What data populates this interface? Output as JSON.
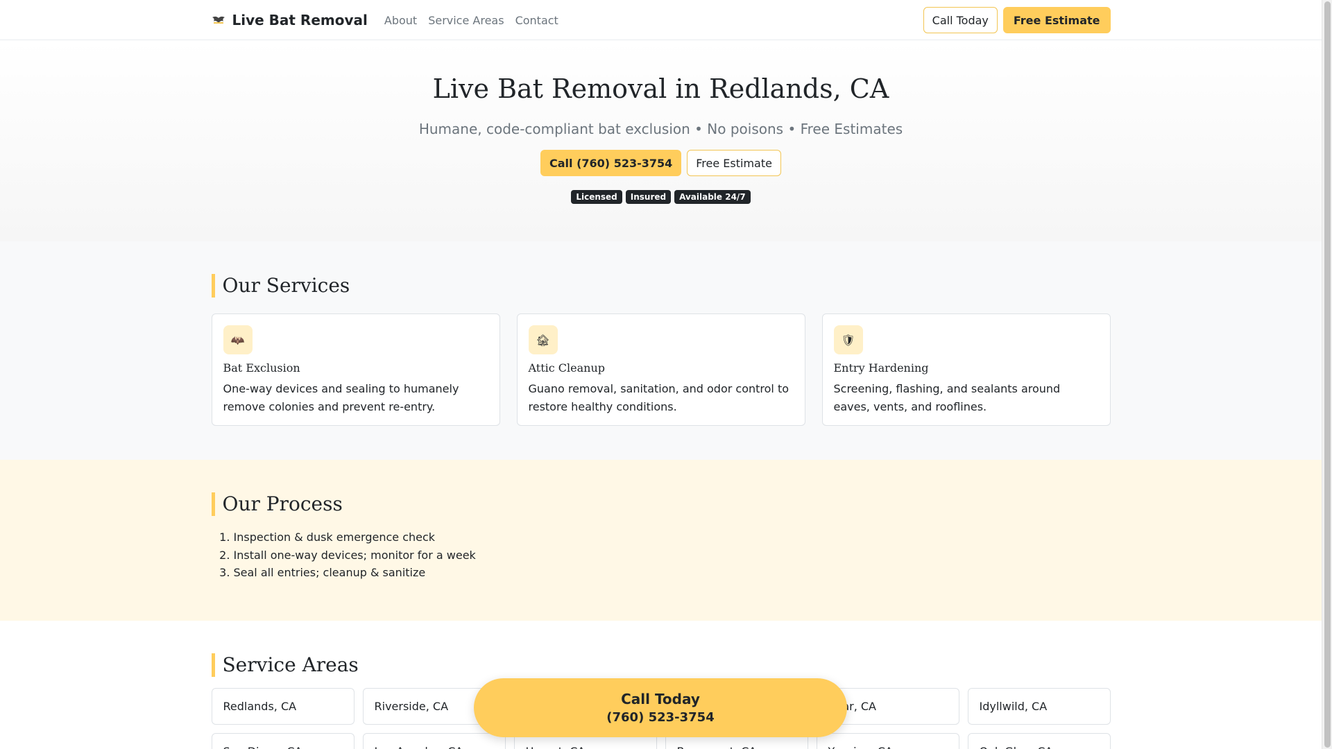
{
  "nav": {
    "brand": "Live Bat Removal",
    "brand_icon": "bat-logo-icon",
    "links": [
      "About",
      "Service Areas",
      "Contact"
    ],
    "call_label": "Call Today",
    "estimate_label": "Free Estimate"
  },
  "hero": {
    "title": "Live Bat Removal in Redlands, CA",
    "lead": "Humane, code-compliant bat exclusion • No poisons • Free Estimates",
    "call_button": "Call (760) 523-3754",
    "estimate_button": "Free Estimate",
    "badges": [
      "Licensed",
      "Insured",
      "Available 24/7"
    ]
  },
  "services": {
    "title": "Our Services",
    "items": [
      {
        "icon": "bat-icon",
        "glyph": "🦇",
        "title": "Bat Exclusion",
        "text": "One-way devices and sealing to humanely remove colonies and prevent re-entry."
      },
      {
        "icon": "house-icon",
        "glyph": "🏚",
        "title": "Attic Cleanup",
        "text": "Guano removal, sanitation, and odor control to restore healthy conditions."
      },
      {
        "icon": "shield-icon",
        "glyph": "🛡",
        "title": "Entry Hardening",
        "text": "Screening, flashing, and sealants around eaves, vents, and rooflines."
      }
    ]
  },
  "process": {
    "title": "Our Process",
    "steps": [
      "Inspection & dusk emergence check",
      "Install one-way devices; monitor for a week",
      "Seal all entries; cleanup & sanitize"
    ]
  },
  "areas": {
    "title": "Service Areas",
    "items": [
      "Redlands, CA",
      "Riverside, CA",
      "",
      "",
      "Bear, CA",
      "Idyllwild, CA",
      "San Diego, CA",
      "Los Angeles, CA",
      "Hemet, CA",
      "Beaumont, CA",
      "Yucaipa, CA",
      "Oak Glen, CA"
    ]
  },
  "floating_cta": {
    "line1": "Call Today",
    "line2": "(760) 523-3754"
  },
  "colors": {
    "accent": "#ffcd5c",
    "badge": "#212529",
    "process_bg": "#fff8e6"
  }
}
